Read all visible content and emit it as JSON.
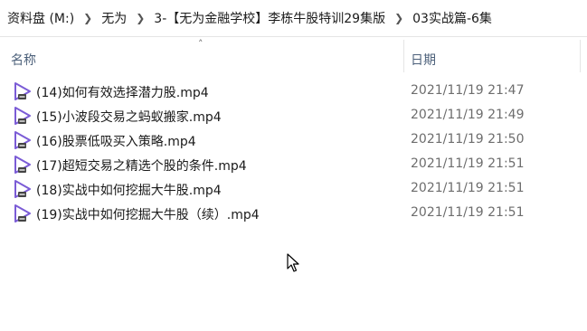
{
  "breadcrumb": [
    "资料盘 (M:)",
    "无为",
    "3-【无为金融学校】李栋牛股特训29集版",
    "03实战篇-6集"
  ],
  "columns": {
    "name": "名称",
    "date": "日期"
  },
  "files": [
    {
      "name": "(14)如何有效选择潜力股.mp4",
      "date": "2021/11/19 21:47"
    },
    {
      "name": "(15)小波段交易之蚂蚁搬家.mp4",
      "date": "2021/11/19 21:49"
    },
    {
      "name": "(16)股票低吸买入策略.mp4",
      "date": "2021/11/19 21:50"
    },
    {
      "name": "(17)超短交易之精选个股的条件.mp4",
      "date": "2021/11/19 21:51"
    },
    {
      "name": "(18)实战中如何挖掘大牛股.mp4",
      "date": "2021/11/19 21:51"
    },
    {
      "name": "(19)实战中如何挖掘大牛股（续）.mp4",
      "date": "2021/11/19 21:51"
    }
  ],
  "icons": {
    "separator": "chevron-right-icon",
    "file": "video-file-icon",
    "sort": "sort-up-icon"
  },
  "colors": {
    "icon_accent": "#7b5cd6",
    "header_text": "#4c607a",
    "date_text": "#6d6d6d"
  }
}
